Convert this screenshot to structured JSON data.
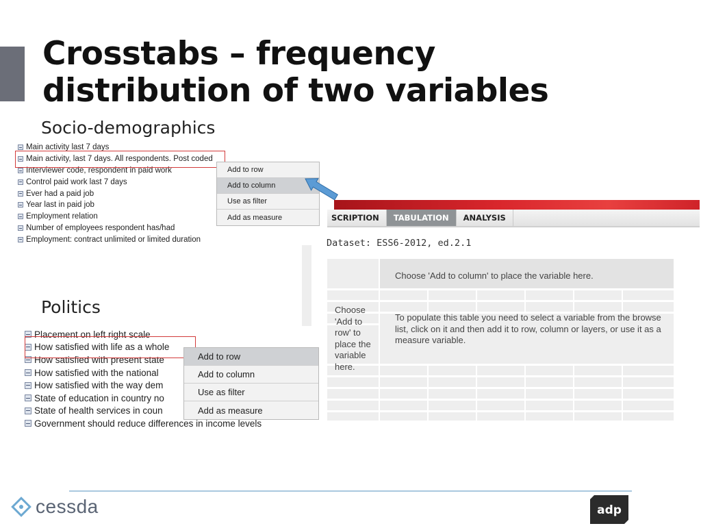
{
  "slide": {
    "title_line1": "Crosstabs – frequency",
    "title_line2": "distribution of two variables"
  },
  "socio": {
    "heading": "Socio-demographics",
    "variables": [
      "Main activity last 7 days",
      "Main activity, last 7 days. All respondents. Post coded",
      "Interviewer code, respondent in paid work",
      "Control paid work last 7 days",
      "Ever had a paid job",
      "Year last in paid job",
      "Employment relation",
      "Number of employees respondent has/had",
      "Employment: contract unlimited or limited duration"
    ],
    "menu": [
      "Add to row",
      "Add to column",
      "Use as filter",
      "Add as measure"
    ],
    "highlighted_index": 1,
    "active_menu_index": 1
  },
  "politics": {
    "heading": "Politics",
    "variables": [
      "Placement on left right scale",
      "How satisfied with life as a whole",
      "How satisfied with present state",
      "How satisfied with the national",
      "How satisfied with the way dem",
      "State of education in country no",
      "State of health services in coun",
      "Government should reduce differences in income levels"
    ],
    "menu": [
      "Add to row",
      "Add to column",
      "Use as filter",
      "Add as measure"
    ],
    "highlighted_index": 1,
    "active_menu_index": 0
  },
  "tabulation": {
    "tabs": [
      "SCRIPTION",
      "TABULATION",
      "ANALYSIS"
    ],
    "active_tab_index": 1,
    "dataset": "Dataset: ESS6-2012, ed.2.1",
    "column_placeholder": "Choose 'Add to column' to place the variable here.",
    "row_placeholder": "Choose 'Add to row' to place the variable here.",
    "instructions": "To populate this table you need to select a variable from the browse list, click on it and then add it to row, column or layers, or use it as a measure variable."
  },
  "footer": {
    "cessda_wordmark": "cessda",
    "adp_logo_text": "adp"
  },
  "colors": {
    "accent_bar": "#6b6e78",
    "highlight_box": "#d23a3a",
    "arrow_fill": "#5b9bd5",
    "red_band": "#d9262c",
    "active_tab": "#8f9396",
    "footer_rule": "#a9c8df"
  },
  "icons": {
    "variable_icon": "variable-list-icon",
    "arrow": "pointer-arrow",
    "logo_left": "cessda-logo",
    "logo_right": "adp-logo"
  }
}
